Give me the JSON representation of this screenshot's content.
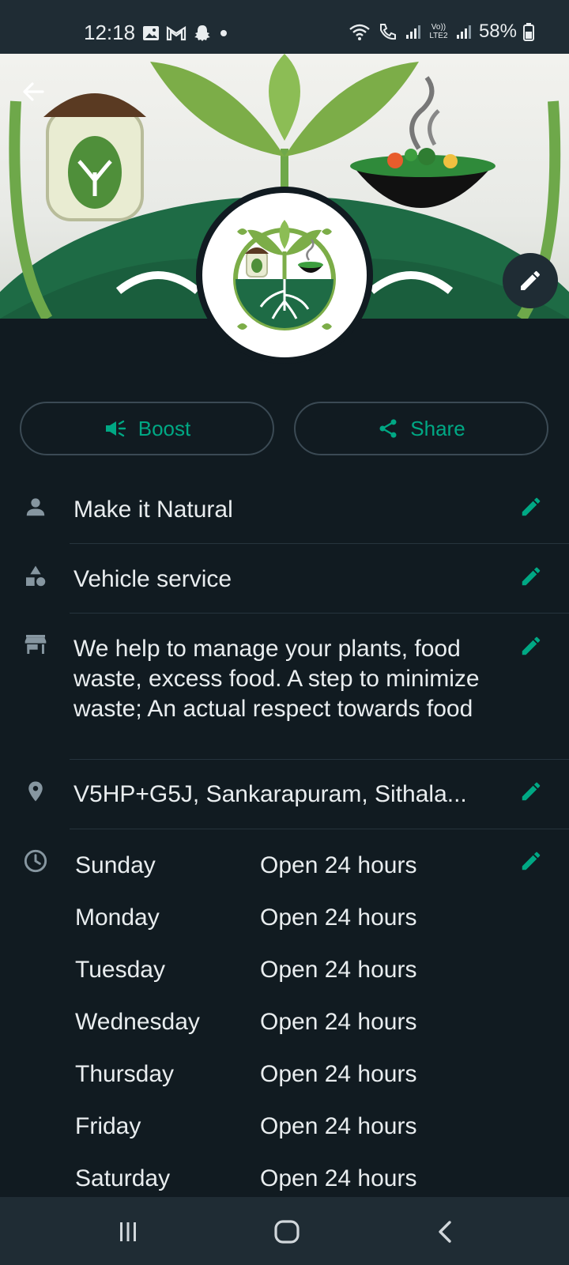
{
  "status_bar": {
    "time": "12:18",
    "battery": "58%",
    "icons_left": [
      "gallery-icon",
      "gmail-icon",
      "snapchat-icon",
      "dot-icon"
    ],
    "icons_right": [
      "wifi-icon",
      "call-icon",
      "signal-icon",
      "volte-icon",
      "signal-icon",
      "battery-icon"
    ],
    "volte_label": "Vo)) LTE2"
  },
  "header": {
    "back_icon": "arrow-left-icon",
    "edit_cover_icon": "pencil-icon"
  },
  "actions": {
    "boost_label": "Boost",
    "share_label": "Share"
  },
  "profile": {
    "name": "Make it Natural",
    "category": "Vehicle service",
    "description": "We help to manage your plants, food waste, excess food. A step to minimize waste; An actual respect towards food",
    "address": "V5HP+G5J, Sankarapuram, Sithala..."
  },
  "hours": [
    {
      "day": "Sunday",
      "value": "Open 24 hours"
    },
    {
      "day": "Monday",
      "value": "Open 24 hours"
    },
    {
      "day": "Tuesday",
      "value": "Open 24 hours"
    },
    {
      "day": "Wednesday",
      "value": "Open 24 hours"
    },
    {
      "day": "Thursday",
      "value": "Open 24 hours"
    },
    {
      "day": "Friday",
      "value": "Open 24 hours"
    },
    {
      "day": "Saturday",
      "value": "Open 24 hours"
    }
  ],
  "colors": {
    "background": "#111b21",
    "accent": "#00a884",
    "text": "#e9edef",
    "icon_muted": "#8696a0",
    "brand_green": "#1e6b45"
  },
  "nav_bar": [
    "recents-icon",
    "home-icon",
    "back-icon"
  ]
}
